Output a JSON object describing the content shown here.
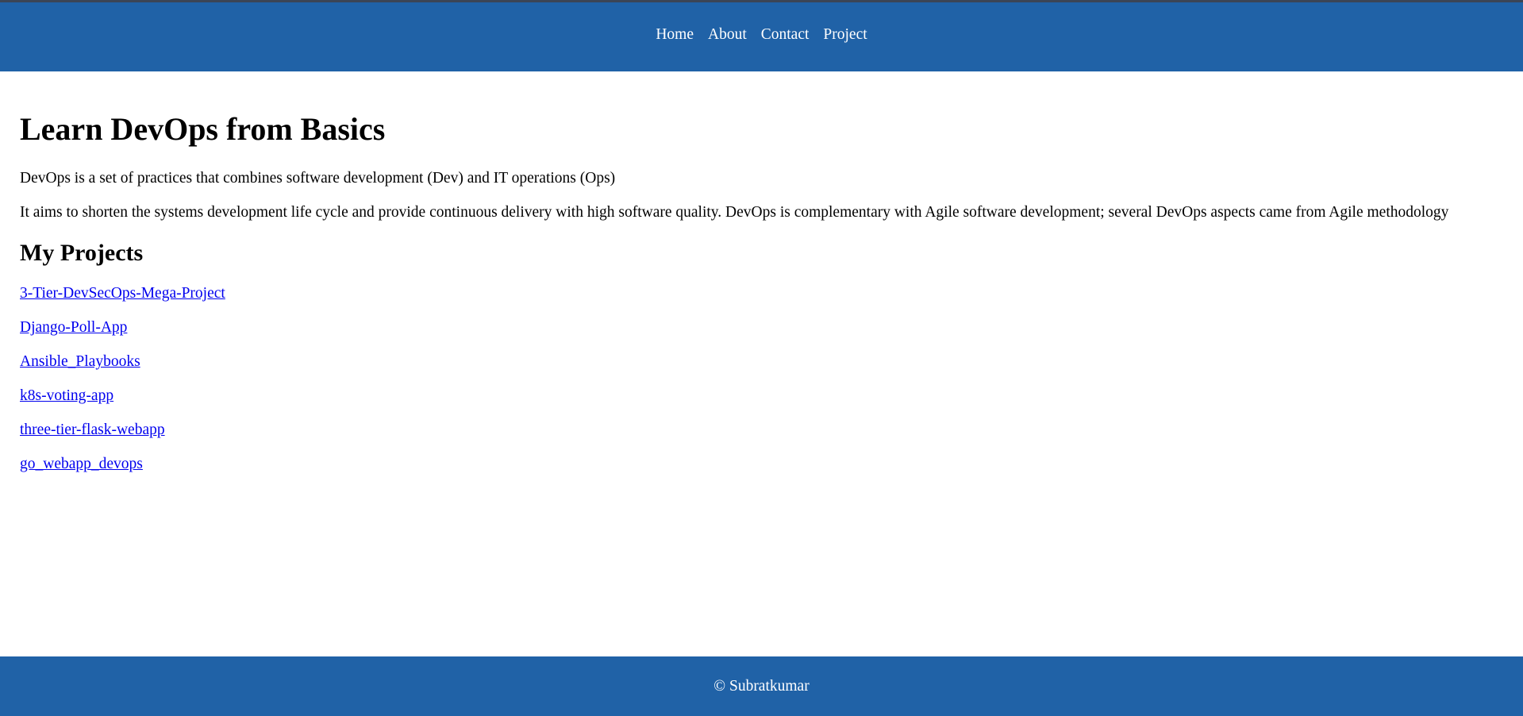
{
  "colors": {
    "header_bg": "#2062a7",
    "footer_bg": "#2062a7",
    "nav_text": "#ffffff",
    "link": "#0000ee"
  },
  "nav": {
    "items": [
      {
        "label": "Home"
      },
      {
        "label": "About"
      },
      {
        "label": "Contact"
      },
      {
        "label": "Project"
      }
    ]
  },
  "main": {
    "title": "Learn DevOps from Basics",
    "paragraphs": [
      "DevOps is a set of practices that combines software development (Dev) and IT operations (Ops)",
      "It aims to shorten the systems development life cycle and provide continuous delivery with high software quality. DevOps is complementary with Agile software development; several DevOps aspects came from Agile methodology"
    ],
    "projects_heading": "My Projects",
    "projects": [
      {
        "label": "3-Tier-DevSecOps-Mega-Project"
      },
      {
        "label": "Django-Poll-App"
      },
      {
        "label": "Ansible_Playbooks"
      },
      {
        "label": "k8s-voting-app"
      },
      {
        "label": "three-tier-flask-webapp"
      },
      {
        "label": "go_webapp_devops"
      }
    ]
  },
  "footer": {
    "text": "© Subratkumar"
  }
}
